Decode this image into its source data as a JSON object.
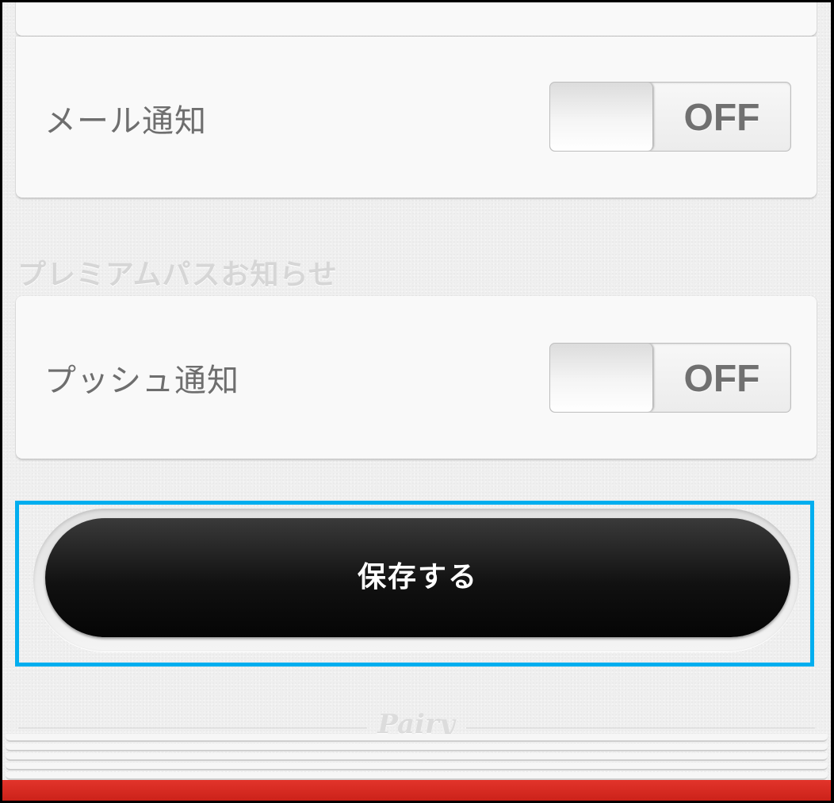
{
  "notifications": {
    "mail": {
      "label": "メール通知",
      "toggle_state": "OFF"
    },
    "premium_pass": {
      "section_title": "プレミアムパスお知らせ",
      "push": {
        "label": "プッシュ通知",
        "toggle_state": "OFF"
      }
    }
  },
  "actions": {
    "save_label": "保存する"
  },
  "footer": {
    "brand": "Pairy"
  },
  "colors": {
    "highlight": "#00aeef",
    "cover": "#d0261e",
    "button": "#111111"
  }
}
